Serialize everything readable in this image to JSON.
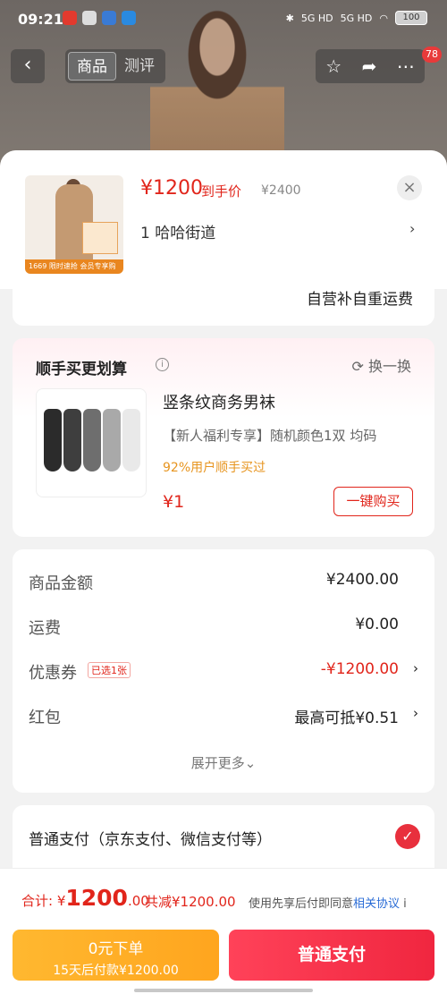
{
  "status_bar": {
    "time": "09:21",
    "battery": "100",
    "signal1": "5G HD",
    "signal2": "5G HD"
  },
  "nav": {
    "back": "‹",
    "tabs": [
      {
        "label": "商品"
      },
      {
        "label": "测评"
      }
    ],
    "badge": "78"
  },
  "product": {
    "price": "¥1200",
    "price_tag": "到手价",
    "original_price": "¥2400",
    "close": "×",
    "address": "1  哈哈街道",
    "thumb_price": "1669",
    "thumb_banner": "限时速抢 会员专享购"
  },
  "shipping": {
    "text": "自营补自重运费"
  },
  "upsell": {
    "title": "顺手买更划算",
    "info": "i",
    "swap": "换一换",
    "name": "竖条纹商务男袜",
    "desc": "【新人福利专享】随机颜色1双   均码",
    "percent": "92%用户顺手买过",
    "price": "¥1",
    "buy": "一键购买"
  },
  "summary": {
    "goods_label": "商品金额",
    "goods_value": "¥2400.00",
    "freight_label": "运费",
    "freight_value": "¥0.00",
    "coupon_label": "优惠券",
    "coupon_tag": "已选1张",
    "coupon_value": "-¥1200.00",
    "redpack_label": "红包",
    "redpack_value": "最高可抵¥0.51",
    "expand": "展开更多⌄"
  },
  "payment": {
    "label": "普通支付（京东支付、微信支付等）",
    "checked": "✓"
  },
  "footer": {
    "total_label": "合计: ",
    "currency": "¥",
    "total_int": "1200",
    "total_dec": ".00",
    "saved": "共减¥1200.00",
    "agree": "使用先享后付即同意",
    "agree_link": "相关协议",
    "agree_icon": "i",
    "later_title": "0元下单",
    "later_sub": "15天后付款¥1200.00",
    "pay_button": "普通支付"
  },
  "colors": {
    "accent": "#e1251b",
    "later_btn": "#ffb830",
    "pay_btn": "#f0263f",
    "link": "#2a6cd6"
  }
}
